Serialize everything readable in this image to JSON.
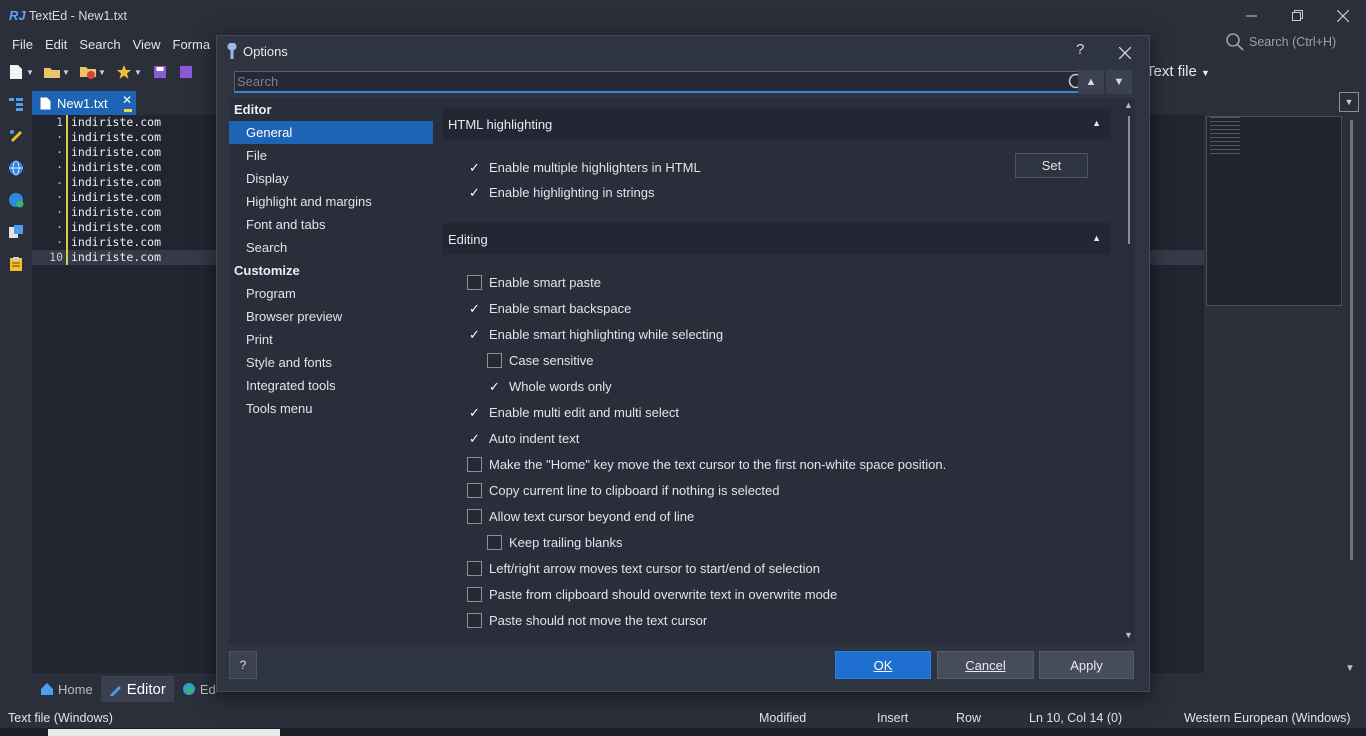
{
  "app": {
    "logo": "RJ",
    "title": "TextEd - New1.txt",
    "window_controls": [
      "minimize",
      "restore",
      "close"
    ]
  },
  "menu": [
    "File",
    "Edit",
    "Search",
    "View",
    "Forma"
  ],
  "app_search": {
    "placeholder": "Search (Ctrl+H)"
  },
  "toolbar": {
    "file_type": "Text file"
  },
  "doc_tab": {
    "label": "New1.txt"
  },
  "editor": {
    "lines": [
      {
        "num": "1",
        "text": "indiriste.com"
      },
      {
        "num": "·",
        "text": "indiriste.com"
      },
      {
        "num": "·",
        "text": "indiriste.com"
      },
      {
        "num": "·",
        "text": "indiriste.com"
      },
      {
        "num": "-",
        "text": "indiriste.com"
      },
      {
        "num": "·",
        "text": "indiriste.com"
      },
      {
        "num": "·",
        "text": "indiriste.com"
      },
      {
        "num": "·",
        "text": "indiriste.com"
      },
      {
        "num": "·",
        "text": "indiriste.com"
      },
      {
        "num": "10",
        "text": "indiriste.com"
      }
    ]
  },
  "bottom_tabs": [
    "Home",
    "Editor",
    "Ed"
  ],
  "status": {
    "file_type": "Text file (Windows)",
    "modified": "Modified",
    "insert": "Insert",
    "row": "Row",
    "position": "Ln 10, Col 14 (0)",
    "encoding": "Western European (Windows)"
  },
  "dialog": {
    "title": "Options",
    "help_glyph": "?",
    "search_placeholder": "Search",
    "nav": {
      "editor_heading": "Editor",
      "editor_items": [
        "General",
        "File",
        "Display",
        "Highlight and margins",
        "Font and tabs",
        "Search"
      ],
      "customize_heading": "Customize",
      "customize_items": [
        "Program",
        "Browser preview",
        "Print",
        "Style and fonts",
        "Integrated tools",
        "Tools menu"
      ],
      "selected": "General"
    },
    "sections": {
      "html": {
        "title": "HTML highlighting",
        "set_label": "Set",
        "options": [
          {
            "label": "Enable multiple highlighters in HTML",
            "checked": true
          },
          {
            "label": "Enable highlighting in strings",
            "checked": true
          }
        ]
      },
      "editing": {
        "title": "Editing",
        "options": [
          {
            "label": "Enable smart paste",
            "checked": false,
            "indent": false
          },
          {
            "label": "Enable smart backspace",
            "checked": true,
            "indent": false
          },
          {
            "label": "Enable smart highlighting while selecting",
            "checked": true,
            "indent": false
          },
          {
            "label": "Case sensitive",
            "checked": false,
            "indent": true
          },
          {
            "label": "Whole words only",
            "checked": true,
            "indent": true
          },
          {
            "label": "Enable multi edit and multi select",
            "checked": true,
            "indent": false
          },
          {
            "label": "Auto indent text",
            "checked": true,
            "indent": false
          },
          {
            "label": "Make the \"Home\" key move the text cursor to the first non-white space position.",
            "checked": false,
            "indent": false
          },
          {
            "label": "Copy current line to clipboard if nothing is selected",
            "checked": false,
            "indent": false
          },
          {
            "label": "Allow text cursor beyond end of line",
            "checked": false,
            "indent": false
          },
          {
            "label": "Keep trailing blanks",
            "checked": false,
            "indent": true
          },
          {
            "label": "Left/right arrow moves text cursor to start/end of selection",
            "checked": false,
            "indent": false
          },
          {
            "label": "Paste from clipboard should overwrite text in overwrite mode",
            "checked": false,
            "indent": false
          },
          {
            "label": "Paste should not move the text cursor",
            "checked": false,
            "indent": false
          }
        ]
      }
    },
    "footer": {
      "help_label": "?",
      "ok_label": "OK",
      "cancel_label": "Cancel",
      "apply_label": "Apply"
    }
  }
}
